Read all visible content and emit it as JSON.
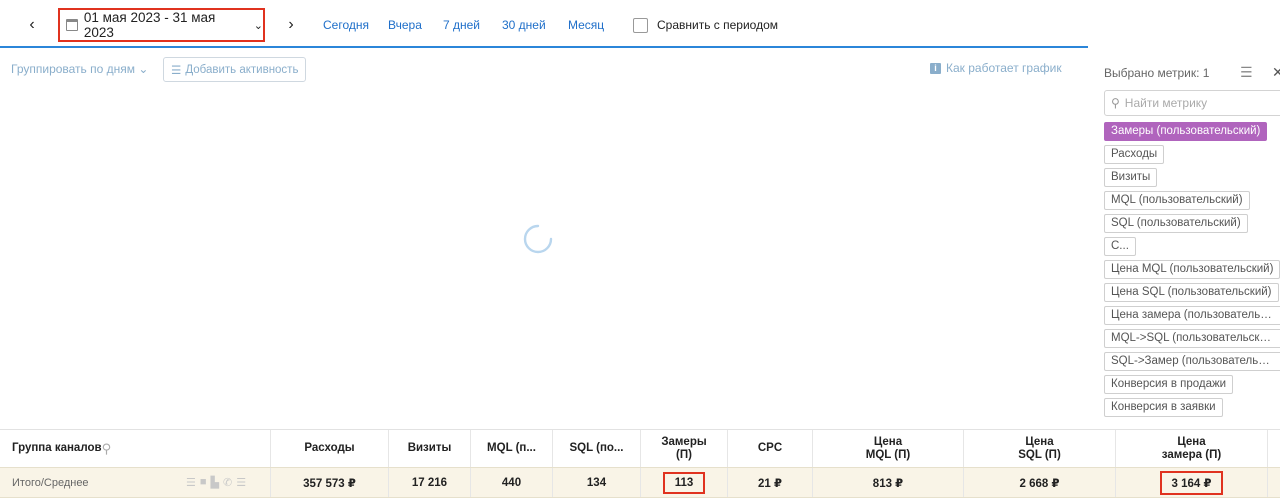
{
  "toolbar": {
    "prev_label": "‹",
    "next_label": "›",
    "date_range": "01 мая 2023 - 31 мая 2023",
    "quick_ranges": [
      "Сегодня",
      "Вчера",
      "7 дней",
      "30 дней",
      "Месяц"
    ],
    "compare_label": "Сравнить с периодом",
    "compare_checked": false
  },
  "chart_area": {
    "group_by": "Группировать по дням",
    "add_activity": "Добавить активность",
    "how_it_works": "Как работает график"
  },
  "metrics": {
    "selected_label": "Выбрано метрик: 1",
    "search_placeholder": "Найти метрику",
    "tags": [
      "Замеры (пользовательский)",
      "Расходы",
      "Визиты",
      "MQL (пользовательский)",
      "SQL (пользовательский)",
      "С...",
      "Цена MQL (пользовательский)",
      "Цена SQL (пользовательский)",
      "Цена замера (пользовательс...",
      "MQL->SQL (пользовательский)",
      "SQL->Замер (пользовательск...",
      "Конверсия в продажи",
      "Конверсия в заявки"
    ],
    "active_index": 0
  },
  "table": {
    "group_header": "Группа каналов",
    "headers": [
      "Расходы",
      "Визиты",
      "MQL (п...",
      "SQL (по...",
      "Замеры\n(П)",
      "CPC",
      "Цена\nMQL (П)",
      "Цена\nSQL (П)",
      "Цена\nзамера (П)"
    ],
    "total_label": "Итого/Среднее",
    "total_values": [
      "357 573 ₽",
      "17 216",
      "440",
      "134",
      "113",
      "21 ₽",
      "813 ₽",
      "2 668 ₽",
      "3 164 ₽"
    ]
  },
  "colors": {
    "accent": "#2b86d9",
    "highlight": "#e0321f",
    "active_tag": "#b064bd",
    "total_row_bg": "#f9f4e7"
  }
}
